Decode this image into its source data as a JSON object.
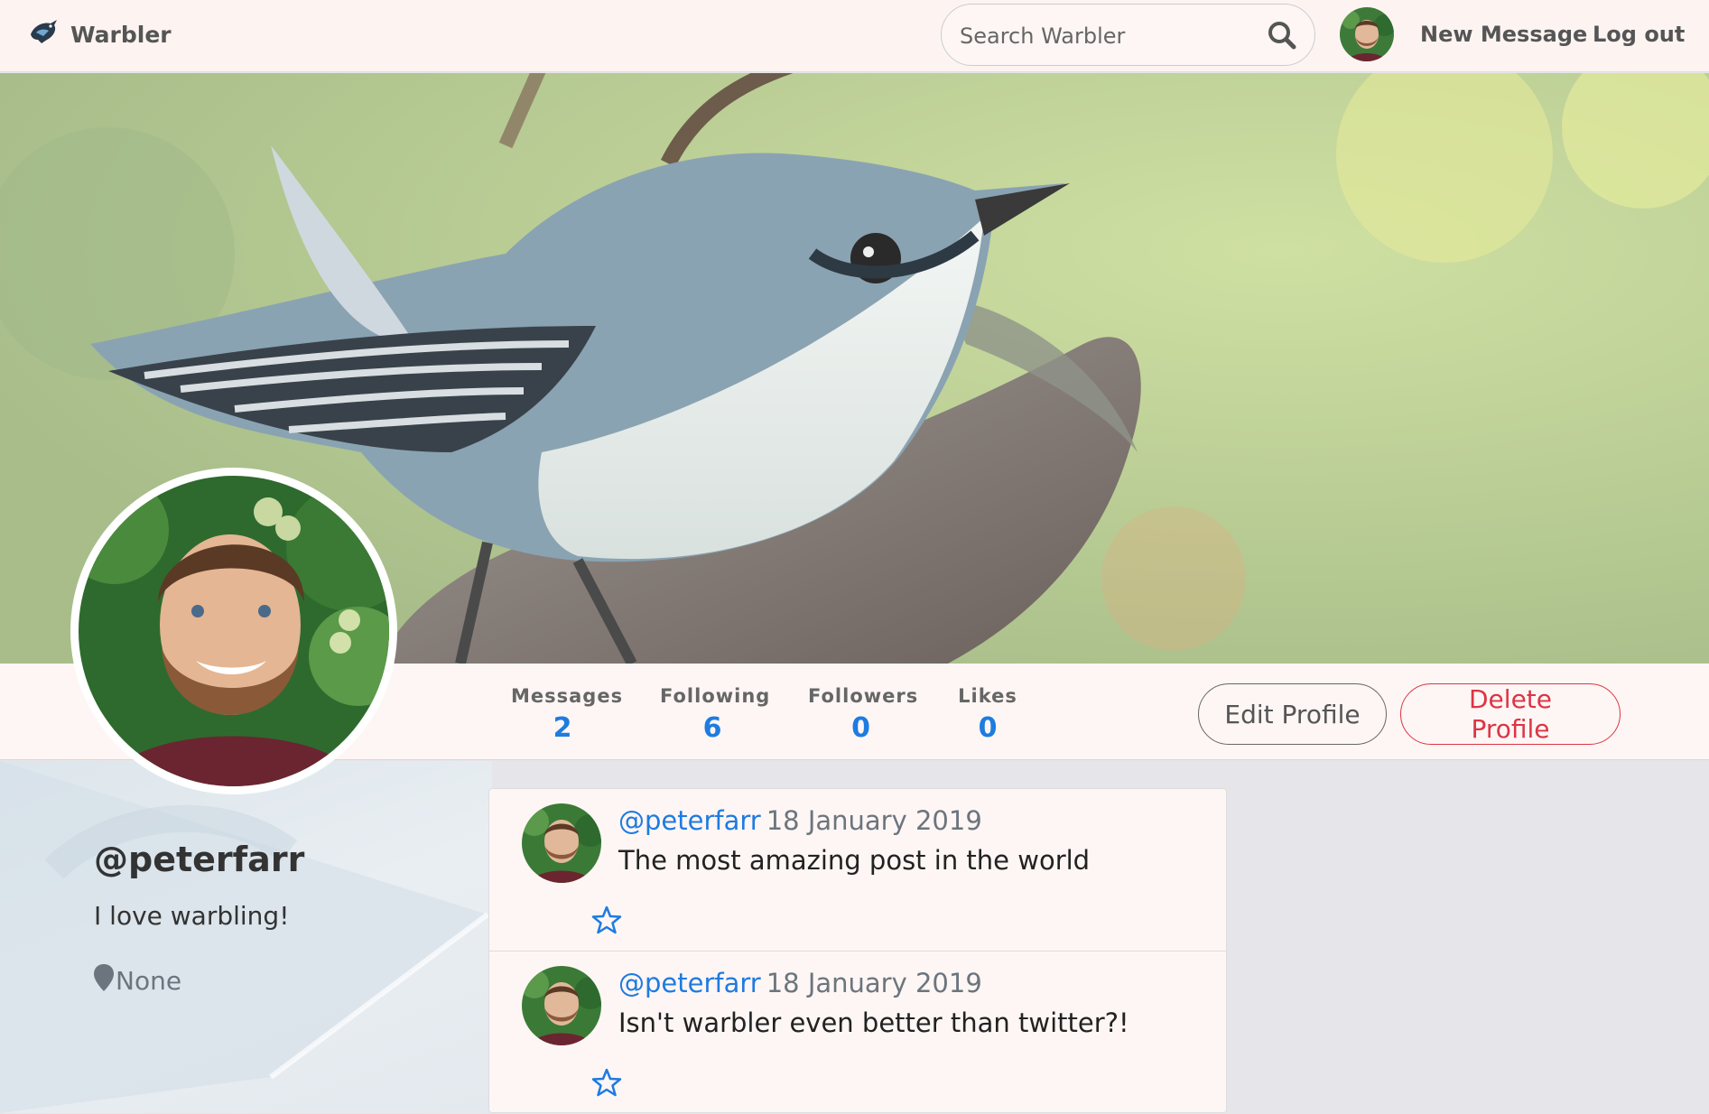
{
  "navbar": {
    "brand": "Warbler",
    "search_placeholder": "Search Warbler",
    "new_message": "New Message",
    "logout": "Log out"
  },
  "stats": [
    {
      "label": "Messages",
      "value": "2"
    },
    {
      "label": "Following",
      "value": "6"
    },
    {
      "label": "Followers",
      "value": "0"
    },
    {
      "label": "Likes",
      "value": "0"
    }
  ],
  "actions": {
    "edit": "Edit Profile",
    "delete": "Delete Profile"
  },
  "profile": {
    "username": "@peterfarr",
    "bio": "I love warbling!",
    "location": "None"
  },
  "messages": [
    {
      "user": "@peterfarr",
      "date": "18 January 2019",
      "text": "The most amazing post in the world"
    },
    {
      "user": "@peterfarr",
      "date": "18 January 2019",
      "text": "Isn't warbler even better than twitter?!"
    }
  ],
  "colors": {
    "link_blue": "#1e7be0",
    "danger_red": "#dc3545",
    "navbar_bg": "#fdf4f2"
  },
  "icons": {
    "brand": "bird-logo-icon",
    "search": "search-icon",
    "location": "map-marker-icon",
    "like": "star-outline-icon"
  }
}
